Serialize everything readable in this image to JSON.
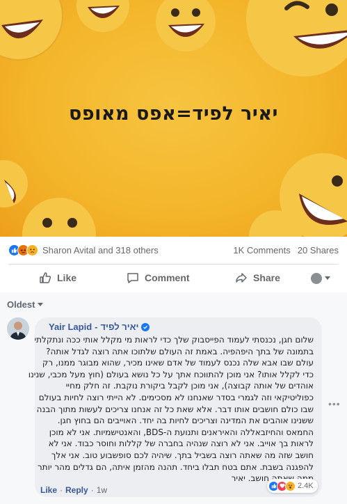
{
  "post": {
    "image_caption": "יאיר לפיד=אפס מאופס",
    "image_background": "#f3b52a"
  },
  "reactions": {
    "icons": [
      "like-icon",
      "angry-icon",
      "sad-icon"
    ],
    "summary": "Sharon Avital and 318 others",
    "comments_count": "1K Comments",
    "shares_count": "20 Shares"
  },
  "actions": {
    "like": "Like",
    "comment": "Comment",
    "share": "Share"
  },
  "comments": {
    "sort_label": "Oldest",
    "items": [
      {
        "author_en": "Yair Lapid",
        "author_sep": "-",
        "author_he": "יאיר לפיד",
        "verified": true,
        "lines": [
          "שלום חגן, נכנסתי לעמוד הפייסבוק שלך כדי לראות מי מקלל אותי ככה ונתקלתי",
          "בתמונה של בתך היפהפיה. באמת זה העולם שלתוכו אתה רוצה לגדל אותה?",
          "עולם שבו אבא שלה נכנס לעמוד של אדם שאינו מכיר, שהוא מבוגר ממנו, רק",
          "כדי לקלל אותו? אני מוכן להתווכח אתך על כל נושא בעולם (חוץ מעל מכבי, שנינו",
          "אוהדים של אותה קבוצה), אני מוכן לקבל ביקורת נוקבת. זה חלק מחיי",
          "כפוליטיקאי וזה לגמרי בסדר שאנחנו לא מסכימים. לא הייתי רוצה לחיות בעולם",
          "שבו כולם חושבים אותו דבר. אלא שאת כל זה אנחנו צריכים לעשות מתוך הבנה",
          "ששנינו אוהבים את המדינה וצריכים לחיות בה יחד. האוייבים הם בחוץ חגן.",
          "החמאס והחיזבאללה והאיראנים ותנועת ה-BDS, והאנטישמיות. אני לא מוכן",
          "לראות בך אוייב. אני לא רוצה שנהיה בחברה של קללות וחוסר כבוד. אני לא",
          "חושב שזה מה שאתה רוצה בשביל בתך. שיהיה לכם סופשבוע טוב. אני אלך",
          "להפגנה בשבת. אתם בטח תבלו ביחד. תהנה מהזמן איתה, הם גדלים מהר יותר",
          "ממה שאתה חושב. יאיר"
        ],
        "reaction_icons": [
          "like-icon",
          "love-icon",
          "wow-icon"
        ],
        "reaction_count": "2.4K",
        "like_label": "Like",
        "reply_label": "Reply",
        "separator": "·",
        "time": "1w"
      }
    ]
  },
  "colors": {
    "link_blue": "#385898",
    "fb_blue": "#1877f2",
    "muted": "#65676b"
  }
}
